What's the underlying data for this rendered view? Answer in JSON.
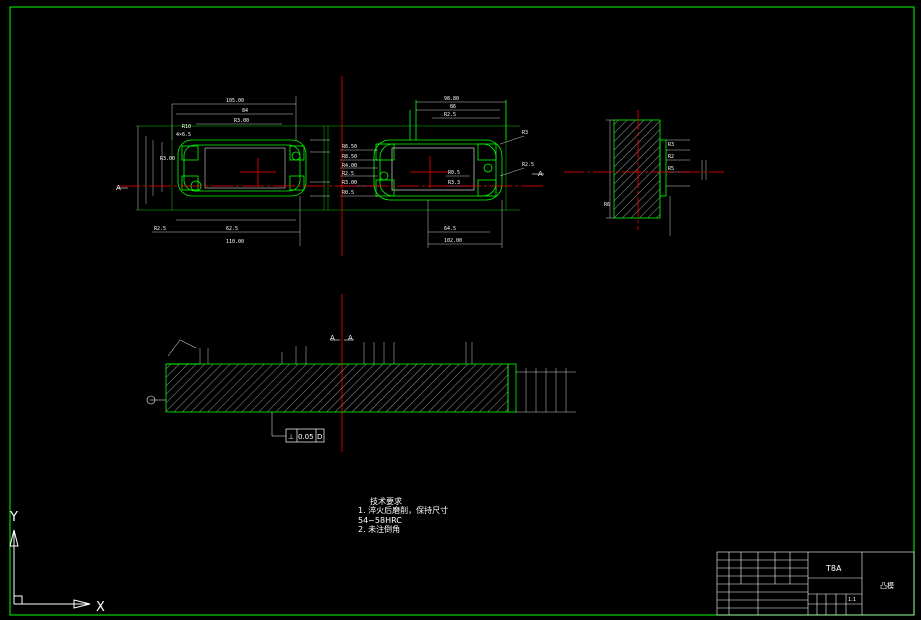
{
  "section_label": "A",
  "gdt": {
    "symbol": "⊥",
    "tolerance": "0.05",
    "datum": "D"
  },
  "notes": {
    "title": "技术要求",
    "line1": "1. 淬火后磨削，保持尺寸",
    "line2": "54~58HRC",
    "line3": "2. 未注倒角"
  },
  "title_block": {
    "material": "T8A",
    "name": "凸模",
    "scale": "1:1"
  },
  "ucs": {
    "y_label": "Y",
    "x_label": "X"
  },
  "colors": {
    "background": "#000000",
    "outline": "#00ff00",
    "centerline": "#ff0000",
    "text": "#ffffff"
  }
}
